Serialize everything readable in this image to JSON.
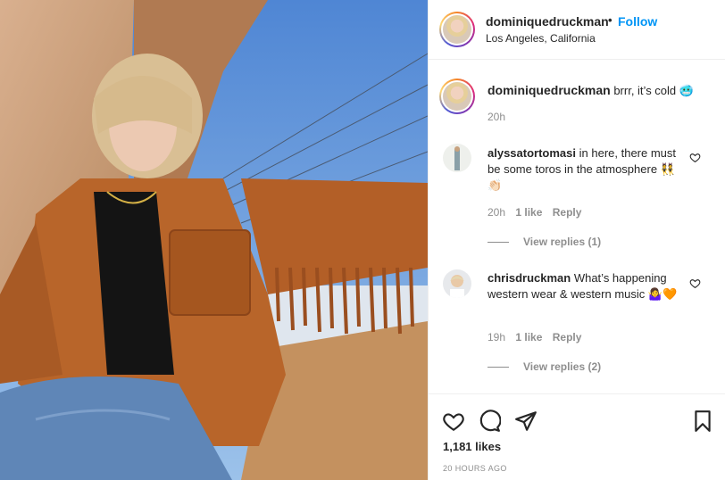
{
  "post": {
    "author": "dominiquedruckman",
    "follow_dot": "•",
    "follow_label": "Follow",
    "location": "Los Angeles, California",
    "caption_author": "dominiquedruckman",
    "caption_text": "brrr, it’s cold 🥶",
    "caption_time": "20h",
    "likes": "1,181 likes",
    "time_ago": "20 HOURS AGO"
  },
  "comments": [
    {
      "author": "alyssatortomasi",
      "text": "in here, there must be some toros in the atmosphere 👯👏🏻",
      "time": "20h",
      "likes": "1 like",
      "reply": "Reply",
      "view_replies": "View replies (1)"
    },
    {
      "author": "chrisdruckman",
      "text": "What’s happening western wear & western music 🤷‍♀️🧡",
      "time": "19h",
      "likes": "1 like",
      "reply": "Reply",
      "view_replies": "View replies (2)"
    }
  ],
  "icons": {
    "like": "heart-icon",
    "comment": "comment-icon",
    "share": "share-icon",
    "save": "bookmark-icon"
  },
  "colors": {
    "link": "#0095f6",
    "muted": "#8e8e8e",
    "text": "#262626"
  }
}
